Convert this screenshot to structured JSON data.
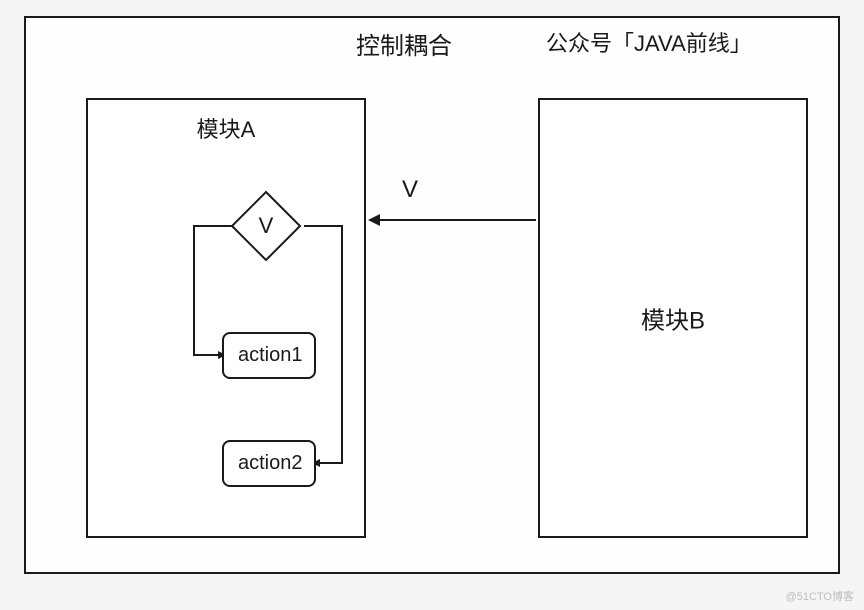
{
  "header": {
    "title": "控制耦合",
    "credit": "公众号「JAVA前线」"
  },
  "modules": {
    "a": {
      "label": "模块A"
    },
    "b": {
      "label": "模块B"
    }
  },
  "decision": {
    "label": "V"
  },
  "actions": {
    "action1": "action1",
    "action2": "action2"
  },
  "connector": {
    "label": "V"
  },
  "watermark": "@51CTO博客"
}
